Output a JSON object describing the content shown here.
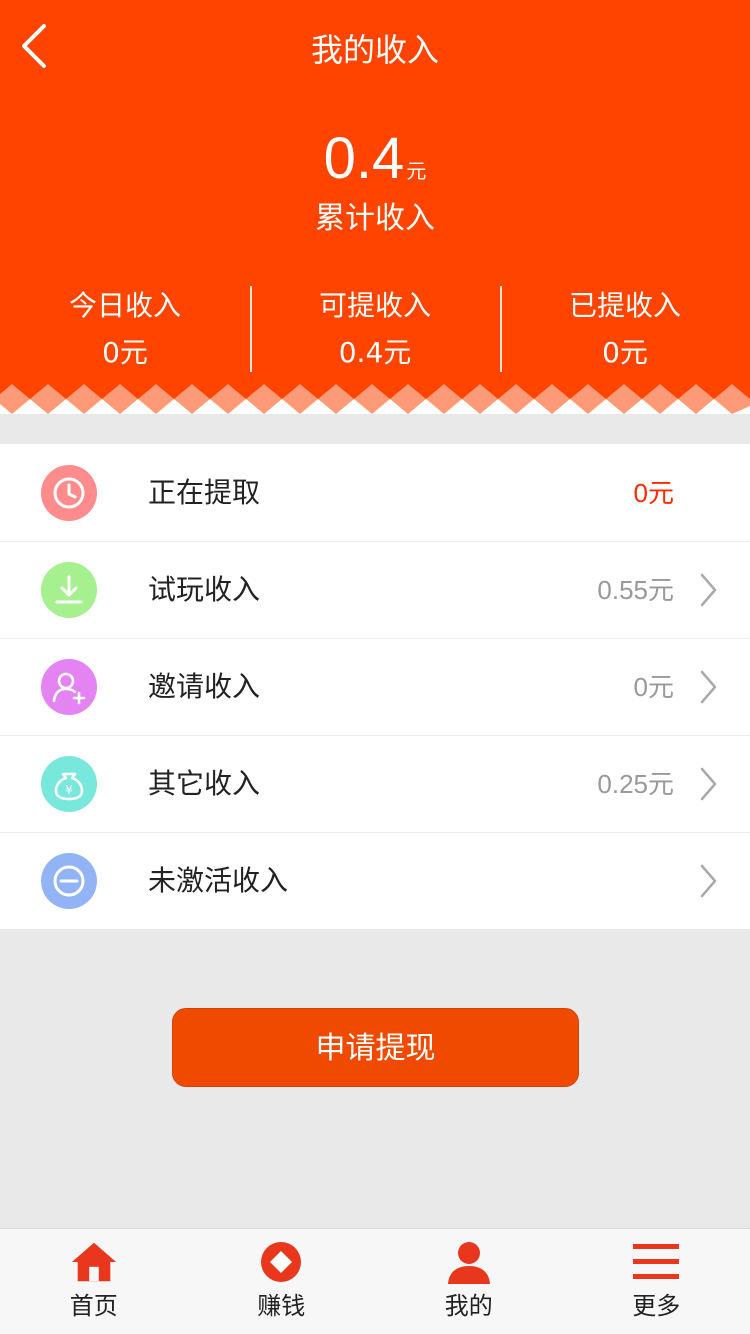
{
  "header": {
    "title": "我的收入",
    "total_value": "0.4",
    "total_unit": "元",
    "total_label": "累计收入",
    "bg_color": "#ff4400"
  },
  "stats": [
    {
      "label": "今日收入",
      "value": "0元"
    },
    {
      "label": "可提收入",
      "value": "0.4元"
    },
    {
      "label": "已提收入",
      "value": "0元"
    }
  ],
  "list": [
    {
      "label": "正在提取",
      "value": "0元",
      "icon": "clock-icon",
      "color": "#ff8c8c",
      "has_chevron": false
    },
    {
      "label": "试玩收入",
      "value": "0.55元",
      "icon": "download-icon",
      "color": "#a6f08f",
      "has_chevron": true
    },
    {
      "label": "邀请收入",
      "value": "0元",
      "icon": "add-user-icon",
      "color": "#e483f2",
      "has_chevron": true
    },
    {
      "label": "其它收入",
      "value": "0.25元",
      "icon": "money-bag-icon",
      "color": "#79e8dc",
      "has_chevron": true
    },
    {
      "label": "未激活收入",
      "value": "",
      "icon": "minus-circle-icon",
      "color": "#92b3f5",
      "has_chevron": true
    }
  ],
  "withdraw_button": "申请提现",
  "tabs": [
    {
      "label": "首页",
      "icon": "home-icon"
    },
    {
      "label": "赚钱",
      "icon": "earn-icon"
    },
    {
      "label": "我的",
      "icon": "user-icon"
    },
    {
      "label": "更多",
      "icon": "menu-icon"
    }
  ],
  "colors": {
    "accent": "#ff4400",
    "button": "#f04a00",
    "red_value": "#ff2a00",
    "tab_icon": "#e8371c"
  }
}
